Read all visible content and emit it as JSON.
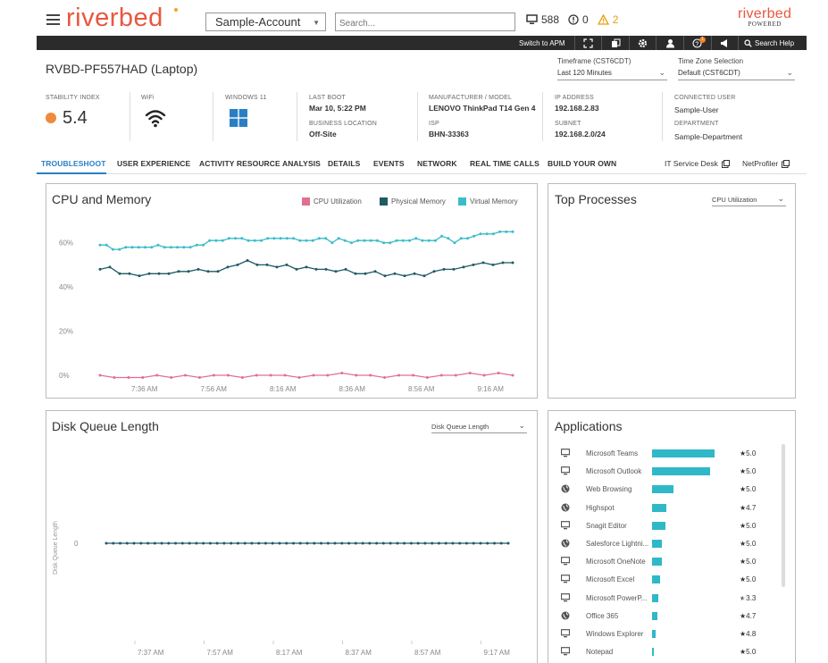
{
  "header": {
    "logo": "riverbed",
    "account": "Sample-Account",
    "search_placeholder": "Search...",
    "device_count": "588",
    "info_count": "0",
    "warning_count": "2",
    "brand_name": "riverbed",
    "brand_sub": "POWERED"
  },
  "toolbar": {
    "switch_label": "Switch to APM",
    "notification_count": "1",
    "search_help": "Search Help"
  },
  "device": {
    "title": "RVBD-PF557HAD (Laptop)",
    "timeframe_label": "Timeframe (CST6CDT)",
    "timeframe_value": "Last 120 Minutes",
    "timezone_label": "Time Zone Selection",
    "timezone_value": "Default (CST6CDT)"
  },
  "info": {
    "stability_label": "STABILITY INDEX",
    "stability_value": "5.4",
    "wifi_label": "WiFi",
    "os_label": "WINDOWS 11",
    "last_boot_label": "LAST BOOT",
    "last_boot_value": "Mar 10, 5:22 PM",
    "location_label": "BUSINESS LOCATION",
    "location_value": "Off-Site",
    "manufacturer_label": "MANUFACTURER / MODEL",
    "manufacturer_value": "LENOVO ThinkPad T14 Gen 4",
    "isp_label": "ISP",
    "isp_value": "BHN-33363",
    "ip_label": "IP ADDRESS",
    "ip_value": "192.168.2.83",
    "subnet_label": "SUBNET",
    "subnet_value": "192.168.2.0/24",
    "user_label": "CONNECTED USER",
    "user_value": "Sample-User",
    "department_label": "DEPARTMENT",
    "department_value": "Sample-Department"
  },
  "tabs": {
    "items": [
      "TROUBLESHOOT",
      "USER EXPERIENCE",
      "ACTIVITY RESOURCE ANALYSIS",
      "DETAILS",
      "EVENTS",
      "NETWORK",
      "REAL TIME CALLS",
      "BUILD YOUR OWN"
    ],
    "active": "TROUBLESHOOT",
    "link_itsm": "IT Service Desk",
    "link_netprofiler": "NetProfiler"
  },
  "colors": {
    "accent": "#2a7fc4",
    "cpu": "#e07090",
    "physical": "#1f5a66",
    "virtual": "#3bbcc9",
    "app_bar": "#2fb8c8",
    "stability": "#f08a3c"
  },
  "cpu_panel": {
    "title": "CPU and Memory",
    "legend": [
      "CPU Utilization",
      "Physical Memory",
      "Virtual Memory"
    ]
  },
  "top_processes": {
    "title": "Top Processes",
    "select": "CPU Utilization"
  },
  "disk_panel": {
    "title": "Disk Queue Length",
    "select": "Disk Queue Length",
    "ylabel": "Disk Queue Length"
  },
  "applications": {
    "title": "Applications",
    "items": [
      {
        "name": "Microsoft Teams",
        "icon": "monitor-icon",
        "usage": 1.0,
        "score": "5.0",
        "star": "full"
      },
      {
        "name": "Microsoft Outlook",
        "icon": "monitor-icon",
        "usage": 0.93,
        "score": "5.0",
        "star": "full"
      },
      {
        "name": "Web Browsing",
        "icon": "globe-icon",
        "usage": 0.34,
        "score": "5.0",
        "star": "full"
      },
      {
        "name": "Highspot",
        "icon": "globe-icon",
        "usage": 0.23,
        "score": "4.7",
        "star": "full"
      },
      {
        "name": "Snagit Editor",
        "icon": "monitor-icon",
        "usage": 0.21,
        "score": "5.0",
        "star": "full"
      },
      {
        "name": "Salesforce Lightni...",
        "icon": "globe-icon",
        "usage": 0.16,
        "score": "5.0",
        "star": "full"
      },
      {
        "name": "Microsoft OneNote",
        "icon": "monitor-icon",
        "usage": 0.15,
        "score": "5.0",
        "star": "full"
      },
      {
        "name": "Microsoft Excel",
        "icon": "monitor-icon",
        "usage": 0.13,
        "score": "5.0",
        "star": "full"
      },
      {
        "name": "Microsoft PowerP...",
        "icon": "monitor-icon",
        "usage": 0.1,
        "score": "3.3",
        "star": "half"
      },
      {
        "name": "Office 365",
        "icon": "globe-icon",
        "usage": 0.09,
        "score": "4.7",
        "star": "full"
      },
      {
        "name": "Windows Explorer",
        "icon": "monitor-icon",
        "usage": 0.06,
        "score": "4.8",
        "star": "full"
      },
      {
        "name": "Notepad",
        "icon": "monitor-icon",
        "usage": 0.03,
        "score": "5.0",
        "star": "full"
      }
    ]
  },
  "chart_data": [
    {
      "type": "line",
      "title": "CPU and Memory",
      "xlabel": "",
      "ylabel": "",
      "x_ticks": [
        "7:36 AM",
        "7:56 AM",
        "8:16 AM",
        "8:36 AM",
        "8:56 AM",
        "9:16 AM"
      ],
      "y_ticks": [
        "0%",
        "20%",
        "40%",
        "60%"
      ],
      "ylim": [
        0,
        70
      ],
      "grid": false,
      "legend": "top-right",
      "x_minutes": [
        0,
        4,
        8,
        12,
        16,
        20,
        24,
        28,
        32,
        36,
        40,
        44,
        48,
        52,
        56,
        60,
        64,
        68,
        72,
        76,
        80,
        84,
        88,
        92,
        96,
        100,
        104,
        108,
        112,
        116
      ],
      "x_origin_label_minute": 8,
      "series": [
        {
          "name": "CPU Utilization",
          "color": "#e07090",
          "values": [
            0,
            -1,
            -1,
            -1,
            0,
            -1,
            0,
            -1,
            0,
            0,
            -1,
            0,
            0,
            0,
            -1,
            0,
            0,
            1,
            0,
            0,
            -1,
            0,
            0,
            -1,
            0,
            0,
            1,
            0,
            1,
            0
          ]
        },
        {
          "name": "Physical Memory",
          "color": "#1f5a66",
          "values": [
            48,
            49,
            46,
            46,
            45,
            46,
            46,
            46,
            47,
            47,
            48,
            47,
            47,
            49,
            50,
            52,
            50,
            50,
            49,
            50,
            48,
            49,
            48,
            48,
            47,
            48,
            46,
            46,
            47,
            45,
            46,
            45,
            46,
            45,
            47,
            48,
            48,
            49,
            50,
            51,
            50,
            51,
            51
          ]
        },
        {
          "name": "Virtual Memory",
          "color": "#3bbcc9",
          "values": [
            59,
            59,
            57,
            57,
            58,
            58,
            58,
            58,
            58,
            59,
            58,
            58,
            58,
            58,
            58,
            59,
            59,
            61,
            61,
            61,
            62,
            62,
            62,
            61,
            61,
            61,
            62,
            62,
            62,
            62,
            62,
            61,
            61,
            61,
            62,
            62,
            60,
            62,
            61,
            60,
            61,
            61,
            61,
            61,
            60,
            60,
            61,
            61,
            61,
            62,
            61,
            61,
            61,
            63,
            62,
            60,
            62,
            62,
            63,
            64,
            64,
            64,
            65,
            65,
            65
          ]
        }
      ]
    },
    {
      "type": "line",
      "title": "Disk Queue Length",
      "xlabel": "",
      "ylabel": "Disk Queue Length",
      "x_ticks": [
        "7:37 AM",
        "7:57 AM",
        "8:17 AM",
        "8:37 AM",
        "8:57 AM",
        "9:17 AM"
      ],
      "y_ticks": [
        "0"
      ],
      "series": [
        {
          "name": "Disk Queue Length",
          "color": "#1f5a66",
          "values": [
            0,
            0,
            0,
            0,
            0,
            0,
            0,
            0,
            0,
            0,
            0,
            0,
            0,
            0,
            0,
            0,
            0,
            0,
            0,
            0,
            0,
            0,
            0,
            0,
            0,
            0,
            0,
            0,
            0,
            0,
            0,
            0,
            0,
            0,
            0,
            0,
            0,
            0,
            0,
            0,
            0,
            0,
            0,
            0,
            0,
            0,
            0,
            0,
            0,
            0,
            0,
            0,
            0,
            0,
            0,
            0,
            0,
            0,
            0
          ]
        }
      ]
    }
  ]
}
